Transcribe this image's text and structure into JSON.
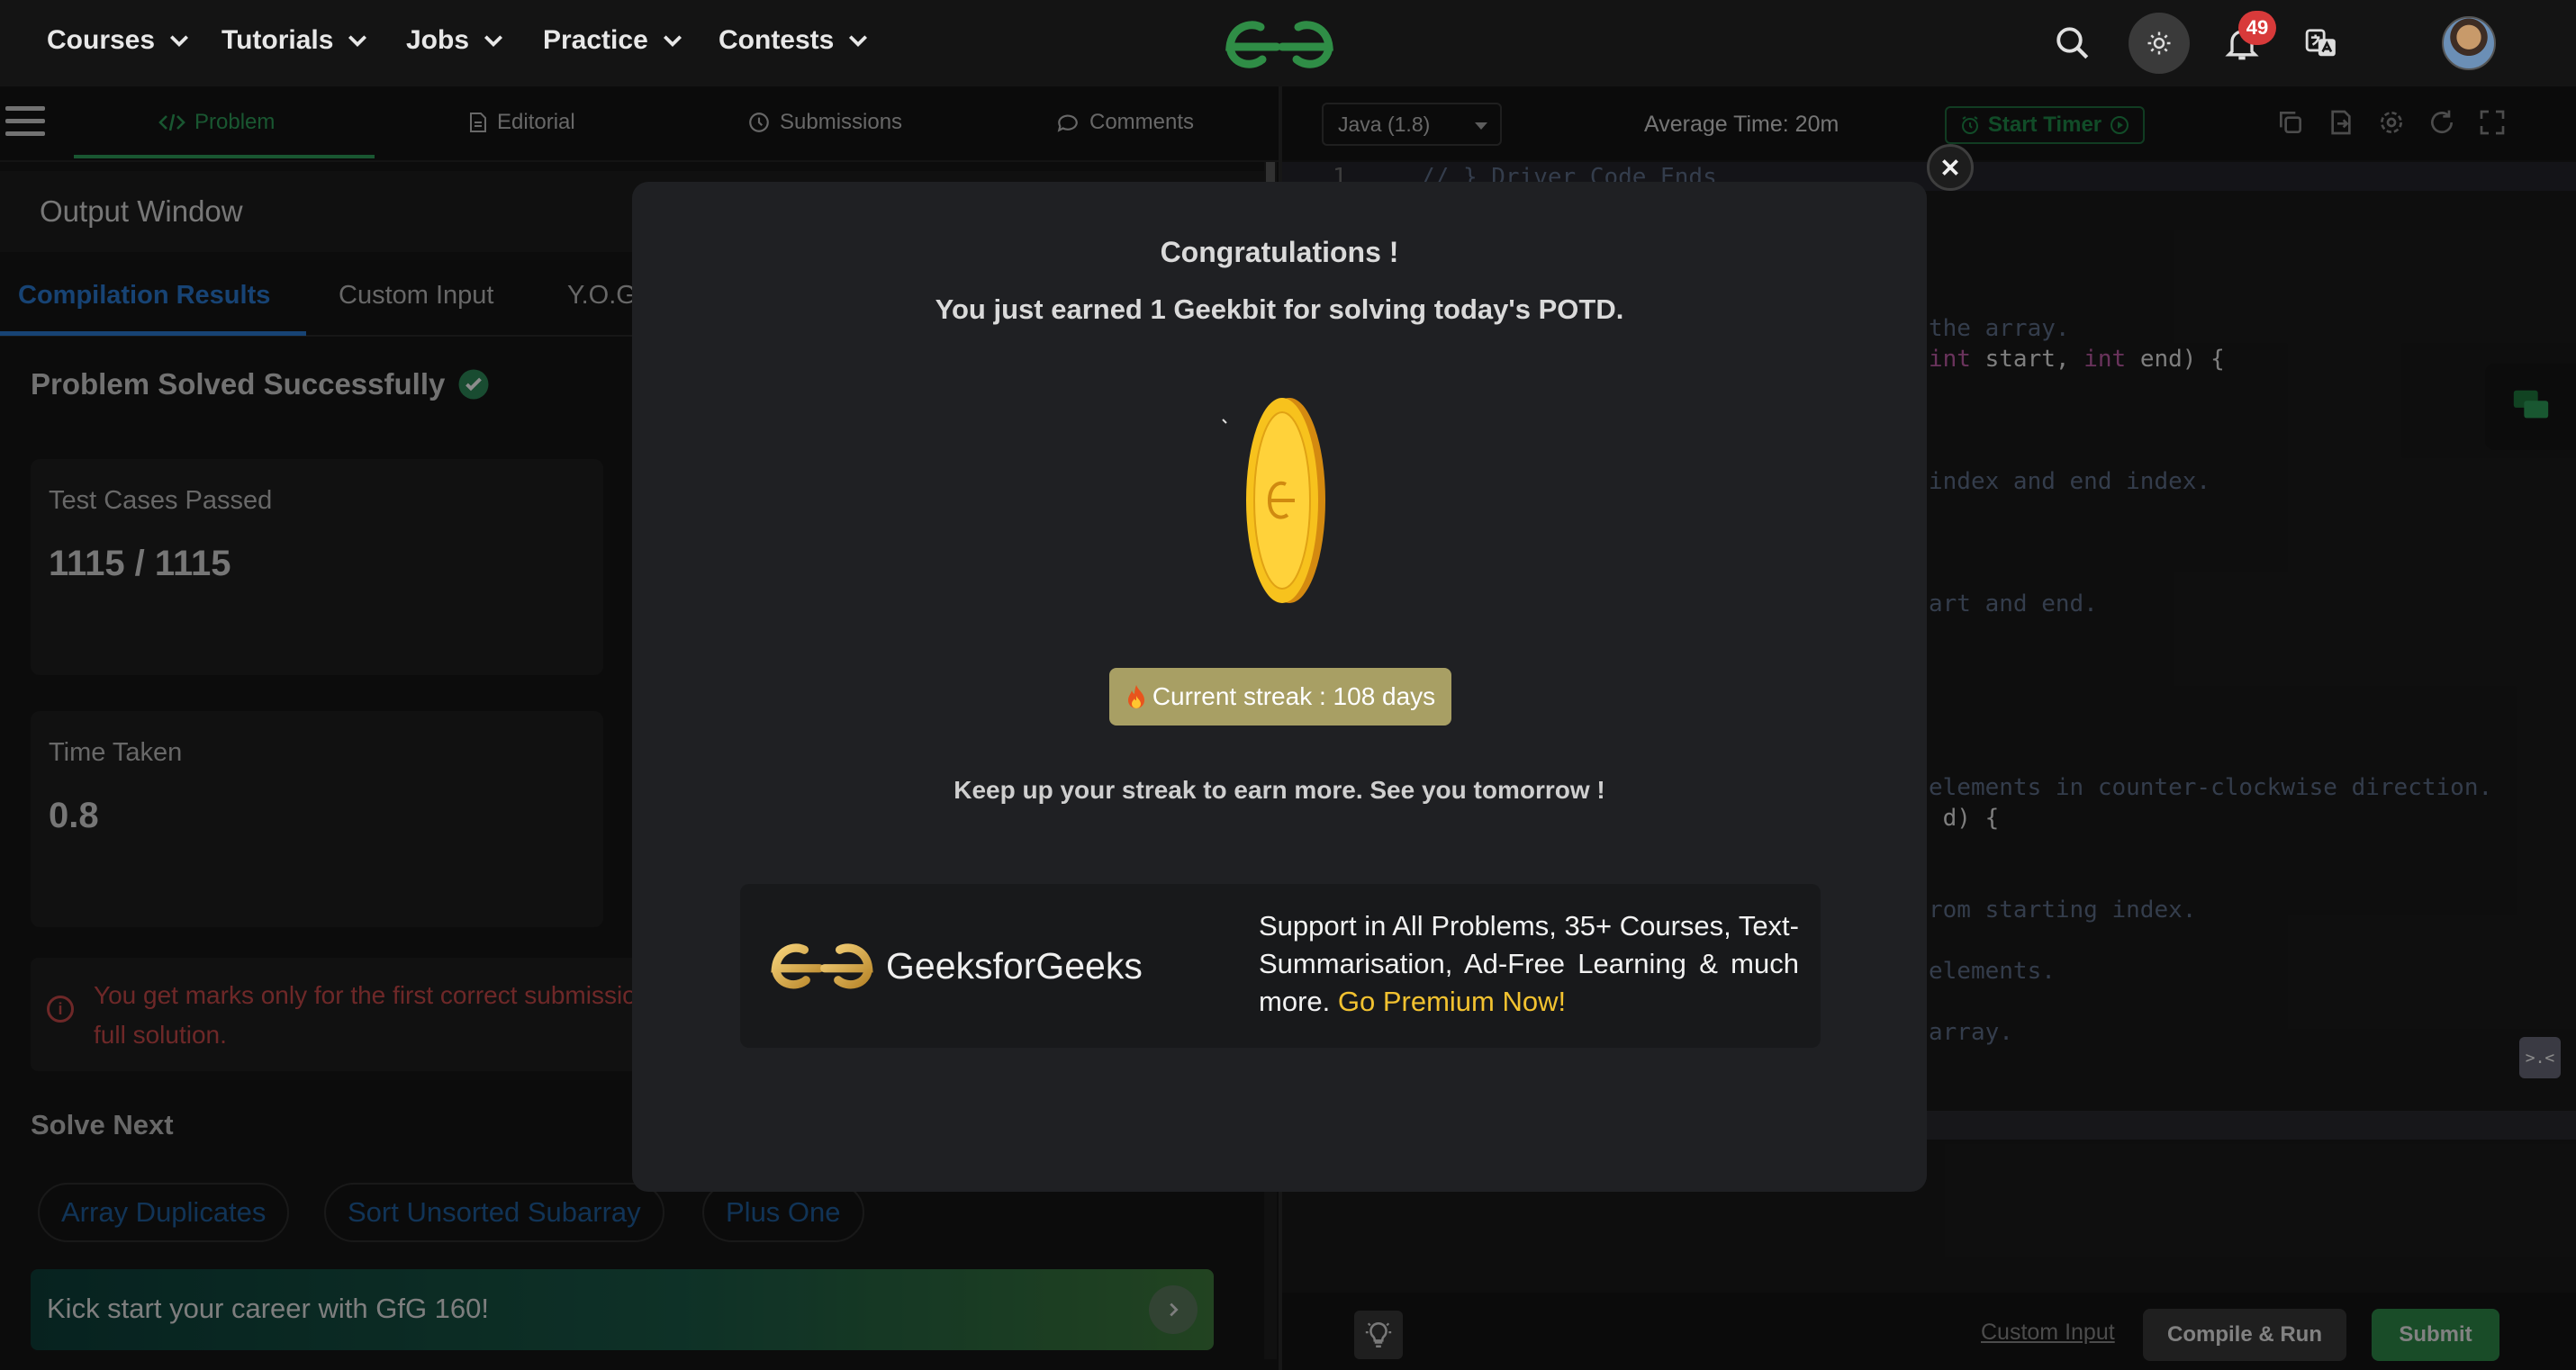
{
  "nav": {
    "items": [
      "Courses",
      "Tutorials",
      "Jobs",
      "Practice",
      "Contests"
    ],
    "notification_count": "49",
    "colors": {
      "brand": "#2f8d46",
      "badge": "#d83a3a"
    }
  },
  "problem_tabs": [
    {
      "label": "Problem",
      "icon": "code-icon"
    },
    {
      "label": "Editorial",
      "icon": "document-icon"
    },
    {
      "label": "Submissions",
      "icon": "clock-icon"
    },
    {
      "label": "Comments",
      "icon": "comment-icon"
    }
  ],
  "output": {
    "title": "Output Window",
    "tabs": [
      "Compilation Results",
      "Custom Input",
      "Y.O.G"
    ],
    "status": "Problem Solved Successfully",
    "test_cases_label": "Test Cases Passed",
    "test_cases_value": "1115 / 1115",
    "time_label": "Time Taken",
    "time_value": "0.8",
    "warning_line1": "You get marks only for the first correct submissio",
    "warning_line2": "full solution.",
    "solve_next_label": "Solve Next",
    "solve_next": [
      "Array Duplicates",
      "Sort Unsorted Subarray",
      "Plus One"
    ],
    "banner": "Kick start your career with GfG 160!"
  },
  "editor": {
    "language": "Java (1.8)",
    "avg_time": "Average Time: 20m",
    "start_timer": "Start Timer",
    "line_number": "1",
    "code_lines": [
      "// } Driver Code Ends",
      "the array.",
      "int start, int end) {",
      "index and end index.",
      "art and end.",
      "elements in counter-clockwise direction.",
      " d) {",
      "rom starting index.",
      "elements.",
      "array."
    ],
    "custom_input": "Custom Input",
    "compile_run": "Compile & Run",
    "submit": "Submit",
    "mini_btn": ">.<"
  },
  "modal": {
    "title": "Congratulations !",
    "subtitle": "You just earned 1 Geekbit for solving today's POTD.",
    "streak": "Current streak : 108 days",
    "keep_up": "Keep up your streak to earn more. See you tomorrow !",
    "brand": "GeeksforGeeks",
    "premium_text": "Support in All Problems, 35+ Courses, Text-Summarisation, Ad-Free Learning & much more.",
    "premium_cta": "Go Premium Now!"
  }
}
